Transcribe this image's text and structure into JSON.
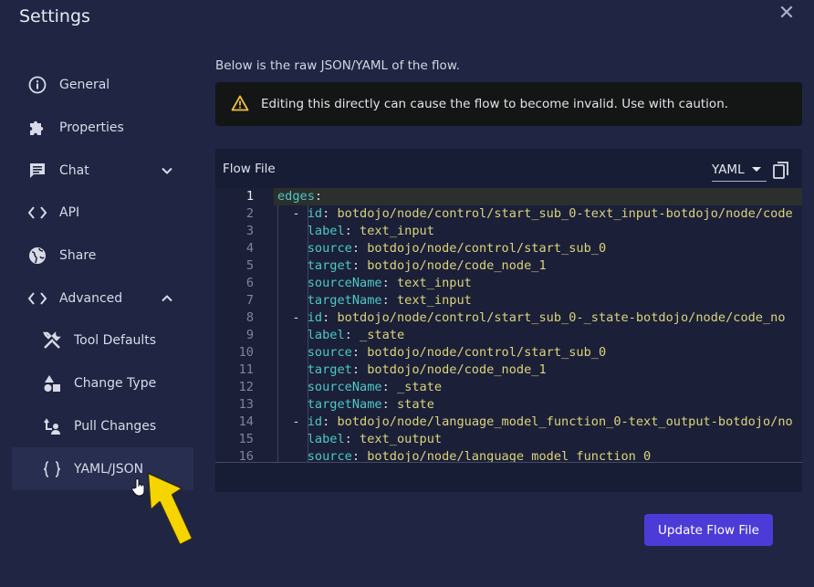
{
  "window": {
    "title": "Settings",
    "close_icon": "close-icon"
  },
  "sidebar": {
    "items": [
      {
        "label": "General",
        "icon": "info-icon"
      },
      {
        "label": "Properties",
        "icon": "puzzle-icon"
      },
      {
        "label": "Chat",
        "icon": "chat-icon",
        "chevron": "chevron-down-icon"
      },
      {
        "label": "API",
        "icon": "code-icon"
      },
      {
        "label": "Share",
        "icon": "globe-icon"
      },
      {
        "label": "Advanced",
        "icon": "code-icon",
        "chevron": "chevron-up-icon",
        "expanded": true
      },
      {
        "label": "Tool Defaults",
        "icon": "tools-icon",
        "sub": true
      },
      {
        "label": "Change Type",
        "icon": "shapes-icon",
        "sub": true
      },
      {
        "label": "Pull Changes",
        "icon": "pull-icon",
        "sub": true
      },
      {
        "label": "YAML/JSON",
        "icon": "braces-icon",
        "sub": true,
        "selected": true
      }
    ]
  },
  "main": {
    "description": "Below is the raw JSON/YAML of the flow.",
    "warning": "Editing this directly can cause the flow to become invalid. Use with caution.",
    "panel": {
      "title": "Flow File",
      "format_selected": "YAML",
      "copy_icon": "copy-icon"
    },
    "editor": {
      "current_line": 1,
      "line_numbers": [
        "1",
        "2",
        "3",
        "4",
        "5",
        "6",
        "7",
        "8",
        "9",
        "10",
        "11",
        "12",
        "13",
        "14",
        "15",
        "16"
      ],
      "lines": [
        {
          "key": "edges",
          "punct": ":",
          "value": ""
        },
        {
          "indent": "  - ",
          "key": "id",
          "punct": ": ",
          "value": "botdojo/node/control/start_sub_0-text_input-botdojo/node/code"
        },
        {
          "indent": "    ",
          "key": "label",
          "punct": ": ",
          "value": "text_input"
        },
        {
          "indent": "    ",
          "key": "source",
          "punct": ": ",
          "value": "botdojo/node/control/start_sub_0"
        },
        {
          "indent": "    ",
          "key": "target",
          "punct": ": ",
          "value": "botdojo/node/code_node_1"
        },
        {
          "indent": "    ",
          "key": "sourceName",
          "punct": ": ",
          "value": "text_input"
        },
        {
          "indent": "    ",
          "key": "targetName",
          "punct": ": ",
          "value": "text_input"
        },
        {
          "indent": "  - ",
          "key": "id",
          "punct": ": ",
          "value": "botdojo/node/control/start_sub_0-_state-botdojo/node/code_no"
        },
        {
          "indent": "    ",
          "key": "label",
          "punct": ": ",
          "value": "_state"
        },
        {
          "indent": "    ",
          "key": "source",
          "punct": ": ",
          "value": "botdojo/node/control/start_sub_0"
        },
        {
          "indent": "    ",
          "key": "target",
          "punct": ": ",
          "value": "botdojo/node/code_node_1"
        },
        {
          "indent": "    ",
          "key": "sourceName",
          "punct": ": ",
          "value": "_state"
        },
        {
          "indent": "    ",
          "key": "targetName",
          "punct": ": ",
          "value": "state"
        },
        {
          "indent": "  - ",
          "key": "id",
          "punct": ": ",
          "value": "botdojo/node/language_model_function_0-text_output-botdojo/no"
        },
        {
          "indent": "    ",
          "key": "label",
          "punct": ": ",
          "value": "text_output"
        },
        {
          "indent": "    ",
          "key": "source",
          "punct": ": ",
          "value": "botdojo/node/language_model_function_0"
        }
      ]
    },
    "update_button": "Update Flow File"
  },
  "overlay": {
    "cursor": "hand-cursor-icon",
    "arrow": "pointer-arrow-icon",
    "arrow_color": "#f5d400"
  },
  "colors": {
    "accent": "#4d3bd7",
    "background": "#1f2543",
    "key": "#4fc8c4",
    "value": "#dcd37a"
  }
}
